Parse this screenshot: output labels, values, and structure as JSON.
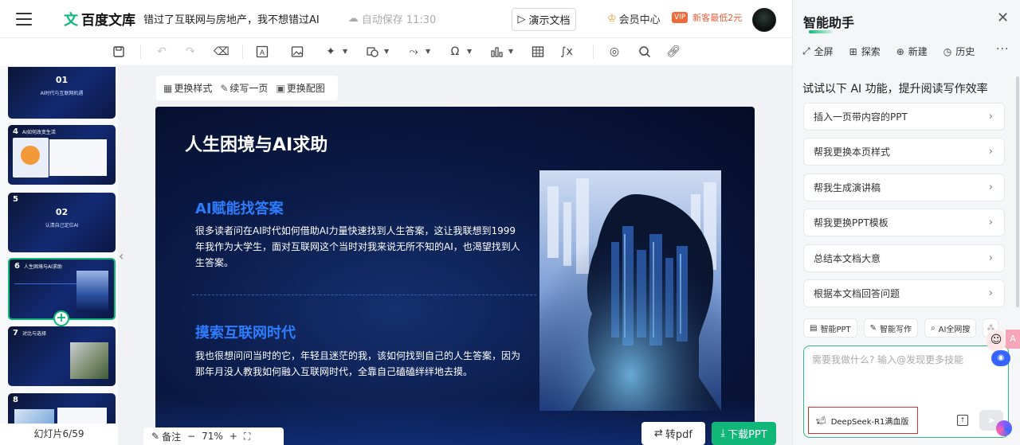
{
  "header": {
    "logo_text": "百度文库",
    "doc_title": "错过了互联网与房地产，我不想错过AI",
    "autosave": "自动保存 11:30",
    "demo_button": "演示文档",
    "vip_label": "会员中心",
    "vip_tag": "VIP",
    "promo_text": "新客最低2元"
  },
  "toolbar": {
    "icons": [
      "save-icon",
      "undo-icon",
      "redo-icon",
      "format-painter-icon",
      "text-box-icon",
      "image-icon",
      "shape-icon",
      "insert-shape-icon",
      "flowchart-icon",
      "symbol-icon",
      "chart-icon",
      "table-icon",
      "formula-icon",
      "record-icon",
      "search-icon",
      "link-icon"
    ]
  },
  "thumbnails": {
    "slides": [
      {
        "number": "01",
        "title": "AI时代与互联网机遇"
      },
      {
        "number": "4",
        "title": "AI如何改变生活"
      },
      {
        "number": "5",
        "big": "02",
        "title": "认清自己定位AI"
      },
      {
        "number": "6",
        "title": "人生困境与AI求助"
      },
      {
        "number": "7",
        "title": "对比与选择"
      },
      {
        "number": "8",
        "title": ""
      }
    ],
    "counter": "幻灯片6/59"
  },
  "slide_actions": {
    "change_style": "更换样式",
    "continue_page": "续写一页",
    "change_image": "更换配图"
  },
  "slide": {
    "title": "人生困境与AI求助",
    "sections": [
      {
        "heading": "AI赋能找答案",
        "body": "很多读者问在AI时代如何借助AI力量快速找到人生答案，这让我联想到1999年我作为大学生，面对互联网这个当时对我来说无所不知的AI，也渴望找到人生答案。"
      },
      {
        "heading": "摸索互联网时代",
        "body": "我也很想问问当时的它，年轻且迷茫的我，该如何找到自己的人生答案，因为那年月没人教我如何融入互联网时代，全靠自己磕磕绊绊地去摸。"
      }
    ]
  },
  "bottom": {
    "notes": "备注",
    "zoom": "71%",
    "to_pdf": "转pdf",
    "download_ppt": "下载PPT"
  },
  "assistant": {
    "title": "智能助手",
    "tabs": [
      "全屏",
      "探索",
      "新建",
      "历史"
    ],
    "heading": "试试以下 AI 功能，提升阅读写作效率",
    "features": [
      "插入一页带内容的PPT",
      "帮我更换本页样式",
      "帮我生成演讲稿",
      "帮我更换PPT模板",
      "总结本文档大意",
      "根据本文档回答问题"
    ],
    "chips": [
      "智能PPT",
      "智能写作",
      "AI全网搜"
    ],
    "input_placeholder": "需要我做什么? 输入@发现更多技能",
    "model": "DeepSeek-R1满血版"
  },
  "colors": {
    "accent": "#10b779",
    "slide_bg": "#0a1a47",
    "heading_blue": "#2e7dff",
    "highlight_red": "#d9302b"
  }
}
